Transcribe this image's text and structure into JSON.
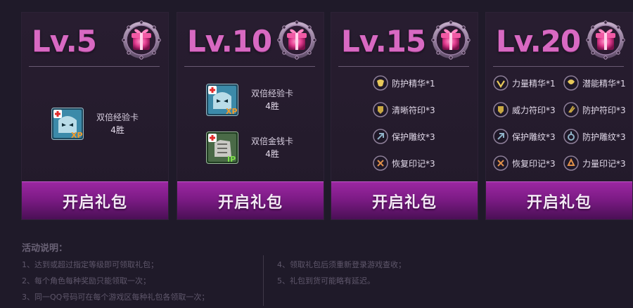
{
  "colors": {
    "accent": "#d869c2",
    "button": "#8a22a0",
    "background": "#1f1a29"
  },
  "cards": [
    {
      "level": "Lv.5",
      "button_label": "开启礼包",
      "rewards": [
        {
          "icon": "xp-card-icon",
          "name": "双倍经验卡",
          "count": "4胜"
        }
      ]
    },
    {
      "level": "Lv.10",
      "button_label": "开启礼包",
      "rewards": [
        {
          "icon": "xp-card-icon",
          "name": "双倍经验卡",
          "count": "4胜"
        },
        {
          "icon": "ip-card-icon",
          "name": "双倍金钱卡",
          "count": "4胜"
        }
      ]
    },
    {
      "level": "Lv.15",
      "button_label": "开启礼包",
      "items": [
        {
          "icon": "armor-essence-icon",
          "label": "防护精华*1"
        },
        {
          "icon": "clarity-rune-icon",
          "label": "清晰符印*3"
        },
        {
          "icon": "protect-glyph-icon",
          "label": "保护雕纹*3"
        },
        {
          "icon": "recovery-seal-icon",
          "label": "恢复印记*3"
        }
      ]
    },
    {
      "level": "Lv.20",
      "button_label": "开启礼包",
      "items": [
        {
          "icon": "strength-essence-icon",
          "label": "力量精华*1"
        },
        {
          "icon": "potential-essence-icon",
          "label": "潜能精华*1"
        },
        {
          "icon": "might-rune-icon",
          "label": "威力符印*3"
        },
        {
          "icon": "defense-rune-icon",
          "label": "防护符印*3"
        },
        {
          "icon": "protect-glyph-icon",
          "label": "保护雕纹*3"
        },
        {
          "icon": "defense-glyph-icon",
          "label": "防护雕纹*3"
        },
        {
          "icon": "recovery-seal-icon",
          "label": "恢复印记*3"
        },
        {
          "icon": "strength-seal-icon",
          "label": "力量印记*3"
        }
      ]
    }
  ],
  "notes": {
    "title": "活动说明：",
    "left": [
      "1、达到或超过指定等级即可领取礼包；",
      "2、每个角色每种奖励只能领取一次；",
      "3、同一QQ号码可在每个游戏区每种礼包各领取一次；"
    ],
    "right": [
      "4、领取礼包后须重新登录游戏查收；",
      "5、礼包到货可能略有延迟。"
    ]
  }
}
